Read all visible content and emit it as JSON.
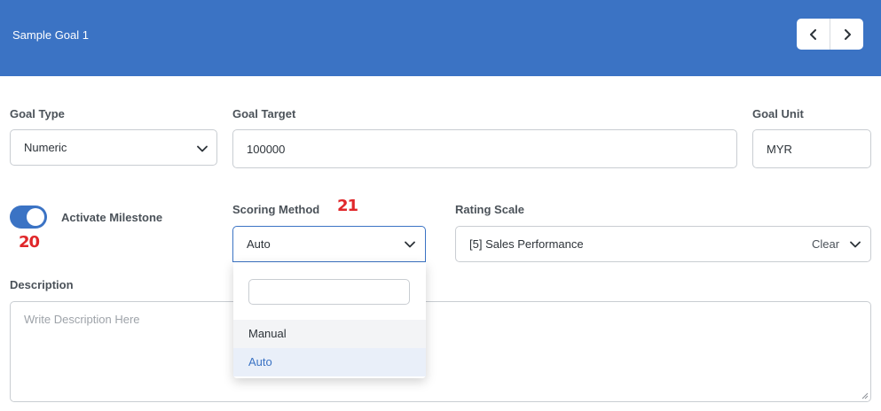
{
  "header": {
    "title": "Sample Goal 1"
  },
  "nav": {
    "prev_icon": "chevron-left-icon",
    "next_icon": "chevron-right-icon"
  },
  "goal_type": {
    "label": "Goal Type",
    "value": "Numeric"
  },
  "goal_target": {
    "label": "Goal Target",
    "value": "100000"
  },
  "goal_unit": {
    "label": "Goal Unit",
    "value": "MYR"
  },
  "milestone": {
    "label": "Activate Milestone",
    "enabled": true,
    "badge": "20"
  },
  "scoring_method": {
    "label": "Scoring Method",
    "value": "Auto",
    "badge": "21",
    "options": [
      "Manual",
      "Auto"
    ],
    "selected": "Auto",
    "search_value": ""
  },
  "rating_scale": {
    "label": "Rating Scale",
    "value": "[5] Sales Performance",
    "clear_label": "Clear"
  },
  "description": {
    "label": "Description",
    "placeholder": "Write Description Here"
  },
  "colors": {
    "primary": "#3b73c4",
    "badge": "#e0272a",
    "border": "#c9cdd2"
  }
}
